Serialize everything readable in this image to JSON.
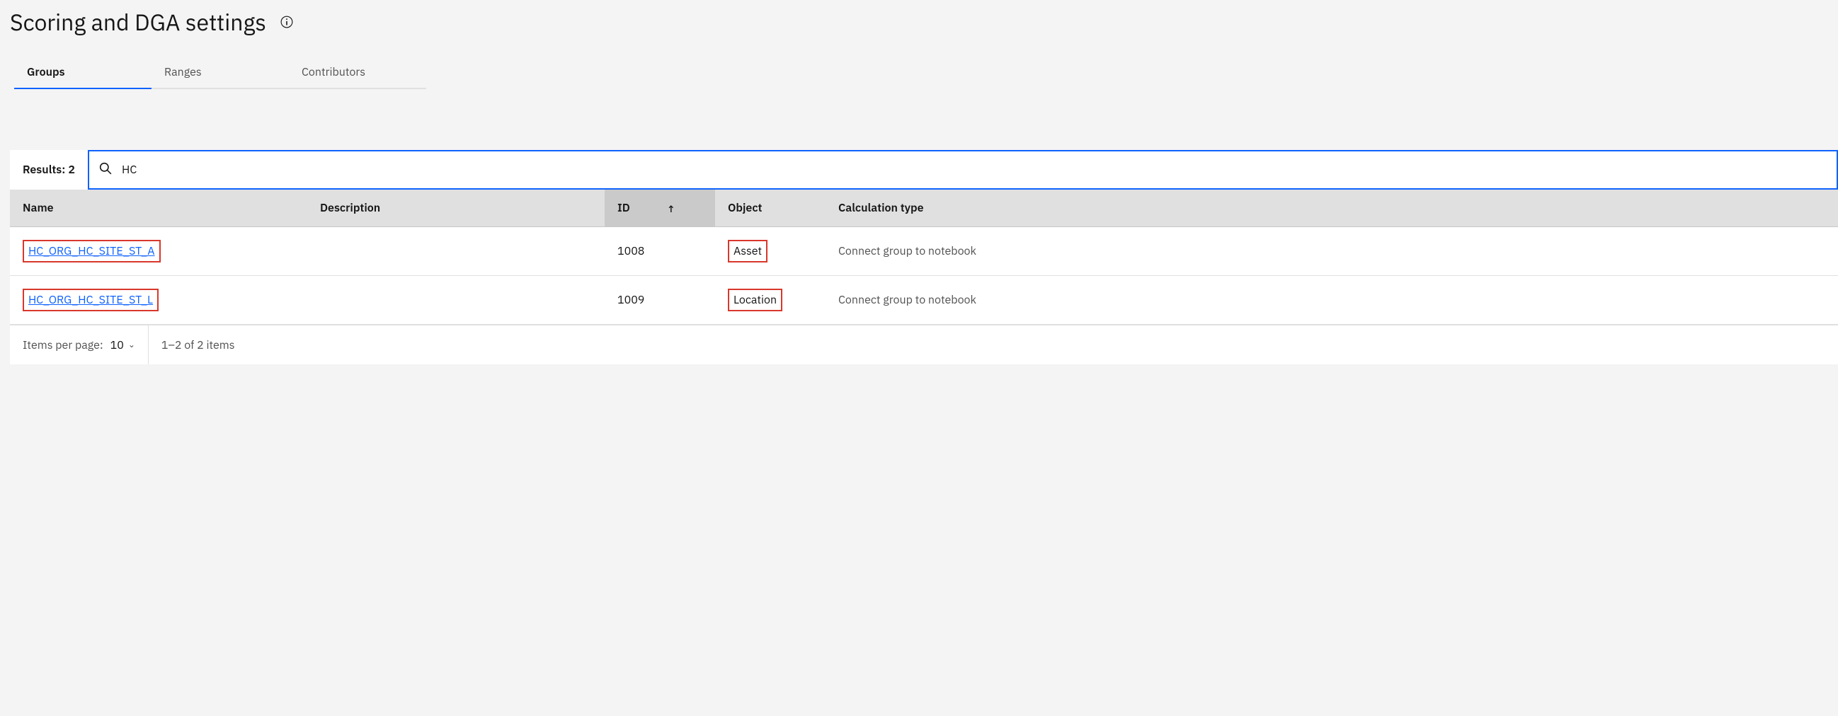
{
  "header": {
    "title": "Scoring and DGA settings"
  },
  "tabs": [
    {
      "label": "Groups",
      "active": true
    },
    {
      "label": "Ranges",
      "active": false
    },
    {
      "label": "Contributors",
      "active": false
    }
  ],
  "results": {
    "label": "Results:",
    "count": "2"
  },
  "search": {
    "value": "HC"
  },
  "columns": {
    "name": "Name",
    "description": "Description",
    "id": "ID",
    "object": "Object",
    "calc": "Calculation type"
  },
  "rows": [
    {
      "name": "HC_ORG_HC_SITE_ST_A",
      "description": "",
      "id": "1008",
      "object": "Asset",
      "calc": "Connect group to notebook"
    },
    {
      "name": "HC_ORG_HC_SITE_ST_L",
      "description": "",
      "id": "1009",
      "object": "Location",
      "calc": "Connect group to notebook"
    }
  ],
  "pagination": {
    "per_page_label": "Items per page:",
    "per_page_value": "10",
    "range_text": "1–2 of 2 items"
  }
}
